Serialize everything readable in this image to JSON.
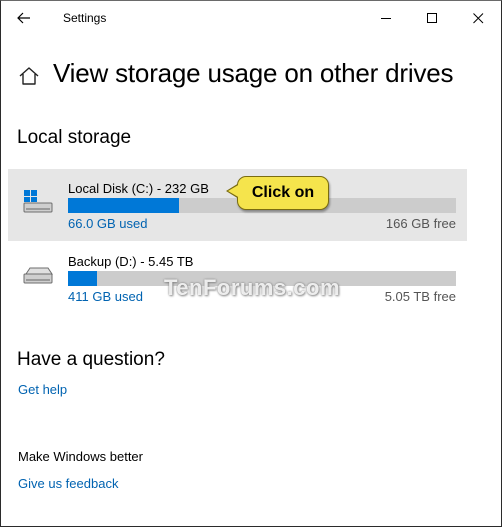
{
  "window": {
    "title": "Settings"
  },
  "page": {
    "title": "View storage usage on other drives"
  },
  "local_storage": {
    "heading": "Local storage",
    "drives": [
      {
        "name": "Local Disk (C:) - 232 GB",
        "used": "66.0 GB used",
        "free": "166 GB free",
        "used_fraction": 0.285,
        "icon": "windows-drive-icon",
        "selected": true
      },
      {
        "name": "Backup (D:) - 5.45 TB",
        "used": "411 GB used",
        "free": "5.05 TB free",
        "used_fraction": 0.074,
        "icon": "hard-drive-icon",
        "selected": false
      }
    ]
  },
  "callout": {
    "text": "Click on"
  },
  "watermark": {
    "text": "TenForums.com"
  },
  "question": {
    "heading": "Have a question?",
    "link": "Get help"
  },
  "feedback": {
    "heading": "Make Windows better",
    "link": "Give us feedback"
  },
  "colors": {
    "accent": "#0078d7",
    "link": "#0063b1",
    "bar_track": "#cccccc",
    "selected_row": "#e6e6e6",
    "callout_fill": "#f5e44c"
  }
}
